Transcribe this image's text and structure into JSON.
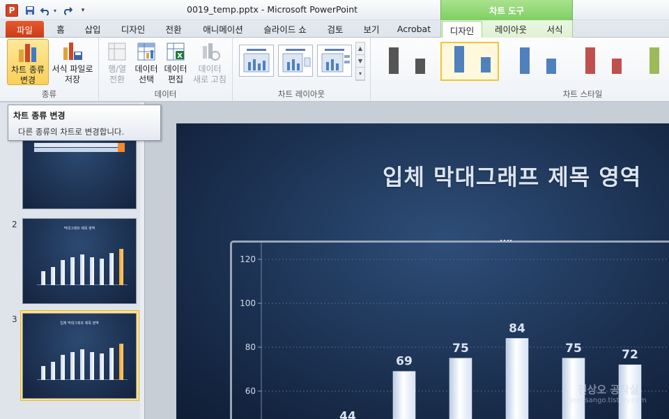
{
  "titlebar": {
    "app_icon_letter": "P",
    "doc_title": "0019_temp.pptx - Microsoft PowerPoint",
    "context_tab_header": "차트 도구"
  },
  "tabs": [
    {
      "label": "파일"
    },
    {
      "label": "홈"
    },
    {
      "label": "삽입"
    },
    {
      "label": "디자인"
    },
    {
      "label": "전환"
    },
    {
      "label": "애니메이션"
    },
    {
      "label": "슬라이드 쇼"
    },
    {
      "label": "검토"
    },
    {
      "label": "보기"
    },
    {
      "label": "Acrobat"
    },
    {
      "label": "디자인"
    },
    {
      "label": "레이아웃"
    },
    {
      "label": "서식"
    }
  ],
  "ribbon": {
    "groups": {
      "type": "종류",
      "data": "데이터",
      "layout": "차트 레이아웃",
      "style": "차트 스타일"
    },
    "buttons": {
      "change_type_1": "차트 종류",
      "change_type_2": "변경",
      "save_template_1": "서식 파일로",
      "save_template_2": "저장",
      "switch_row_col_1": "행/열",
      "switch_row_col_2": "전환",
      "select_data_1": "데이터",
      "select_data_2": "선택",
      "edit_data_1": "데이터",
      "edit_data_2": "편집",
      "refresh_data_1": "데이터",
      "refresh_data_2": "새로 고침"
    },
    "style_colors": [
      "#555555",
      "#4f81bd",
      "#4f81bd",
      "#c0504d",
      "#9bbb59"
    ]
  },
  "tooltip": {
    "title": "차트 종류 변경",
    "description": "다른 종류의 차트로 변경합니다."
  },
  "slides": [
    {
      "number": "2",
      "mini_title": "막대그래프 제목 영역"
    },
    {
      "number": "3",
      "mini_title": "입체 막대그래프 제목 영역"
    }
  ],
  "slide": {
    "title": "입체 막대그래프 제목 영역"
  },
  "chart_data": {
    "type": "bar",
    "y_ticks": [
      60,
      80,
      100,
      120
    ],
    "ylim": [
      40,
      120
    ],
    "data_labels": [
      44,
      69,
      75,
      84,
      75,
      72
    ],
    "values": [
      44,
      69,
      75,
      84,
      75,
      72
    ]
  },
  "watermark": {
    "line1": "전상오 공작실",
    "line2": "jeonsango.tistory.com"
  }
}
